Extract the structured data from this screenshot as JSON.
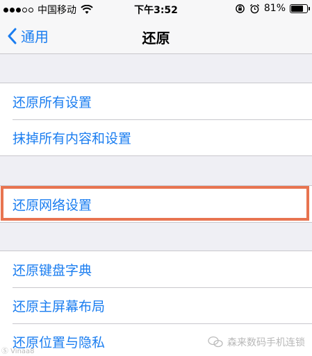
{
  "status_bar": {
    "carrier": "中国移动",
    "time": "下午3:52",
    "battery_text": "81%",
    "battery_level": 0.81,
    "signal_bars": [
      true,
      true,
      true,
      false,
      false
    ]
  },
  "nav": {
    "back_label": "通用",
    "title": "还原"
  },
  "groups": [
    {
      "items": [
        "还原所有设置",
        "抹掉所有内容和设置"
      ]
    },
    {
      "items": [
        "还原网络设置"
      ]
    },
    {
      "items": [
        "还原键盘字典",
        "还原主屏幕布局",
        "还原位置与隐私"
      ]
    }
  ],
  "watermark": {
    "text": "森来数码手机连锁",
    "left_text": "Ⓢ Vinaa8"
  },
  "colors": {
    "accent": "#1a7df0",
    "highlight": "#e87450",
    "background": "#efeff4"
  }
}
